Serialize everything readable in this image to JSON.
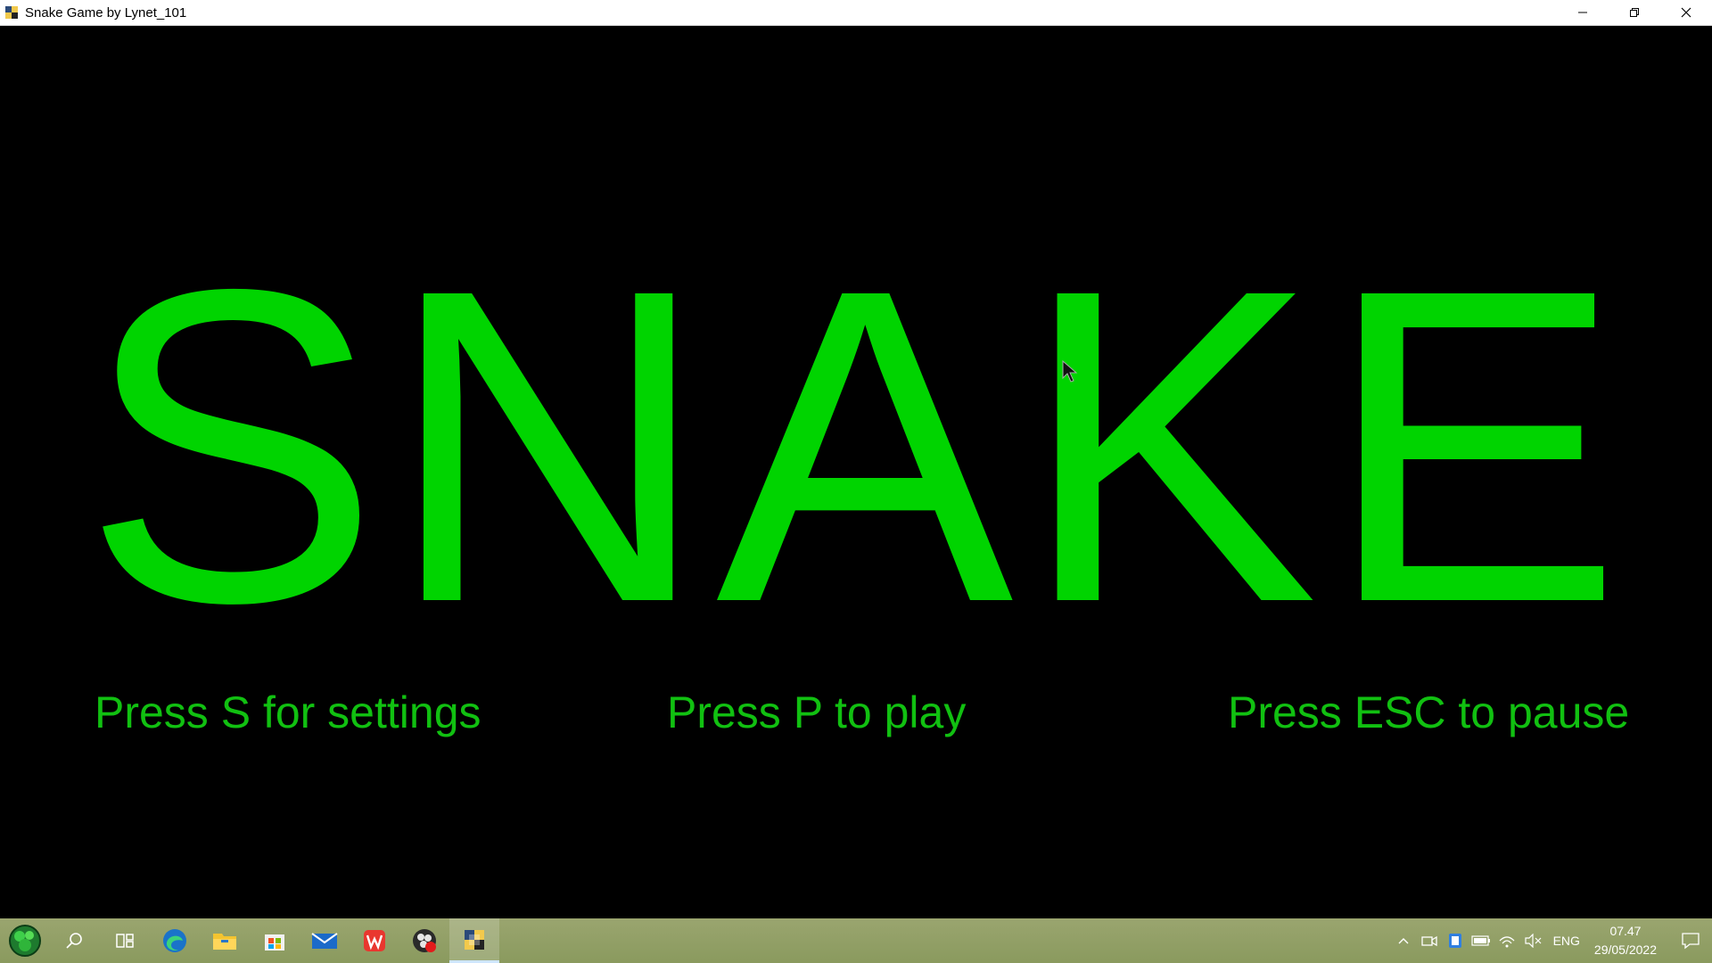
{
  "window": {
    "title": "Snake Game by Lynet_101"
  },
  "game": {
    "title": "SNAKE",
    "hints": {
      "settings": "Press S for settings",
      "play": "Press P to play",
      "pause": "Press ESC to pause"
    },
    "colors": {
      "title": "#00d400",
      "hint": "#11c011",
      "background": "#000000"
    }
  },
  "taskbar": {
    "pinned": [
      "start-icon",
      "search-icon",
      "task-view-icon",
      "edge-icon",
      "file-explorer-icon",
      "store-icon",
      "mail-icon",
      "wps-office-icon",
      "obs-icon",
      "python-app-icon"
    ],
    "tray": {
      "language": "ENG",
      "time": "07.47",
      "date": "29/05/2022"
    }
  }
}
